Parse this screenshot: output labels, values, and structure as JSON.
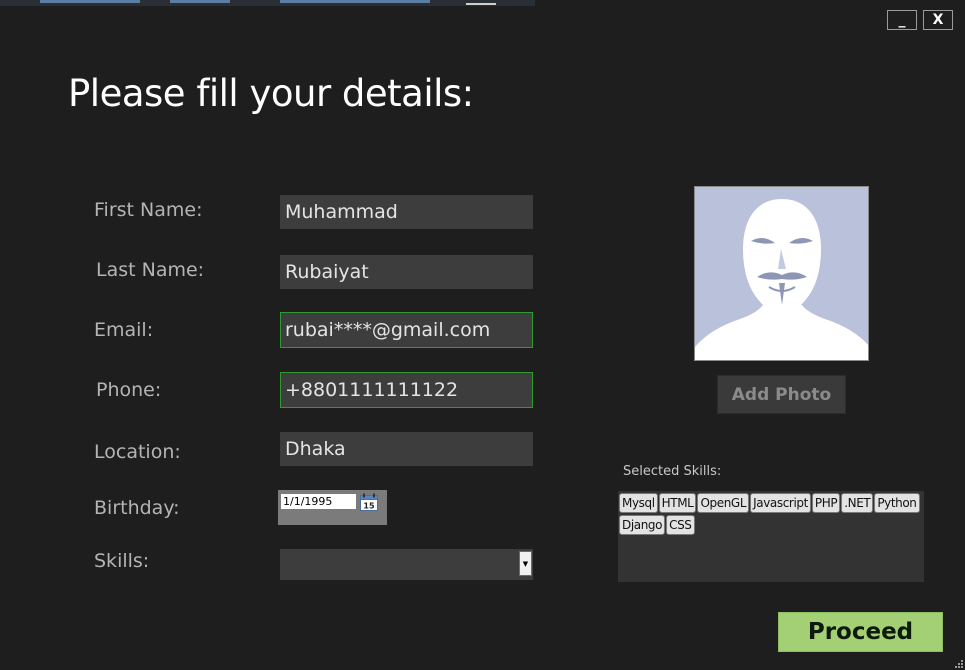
{
  "window": {
    "minimize_label": "_",
    "close_label": "X"
  },
  "heading": "Please fill your details:",
  "form": {
    "first_name": {
      "label": "First Name:",
      "value": "Muhammad"
    },
    "last_name": {
      "label": "Last Name:",
      "value": "Rubaiyat"
    },
    "email": {
      "label": "Email:",
      "value": "rubai****@gmail.com"
    },
    "phone": {
      "label": "Phone:",
      "value": "+8801111111122"
    },
    "location": {
      "label": "Location:",
      "value": "Dhaka"
    },
    "birthday": {
      "label": "Birthday:",
      "value": "1/1/1995",
      "calendar_day": "15"
    },
    "skills": {
      "label": "Skills:",
      "value": ""
    }
  },
  "photo": {
    "add_label": "Add Photo",
    "icon": "anonymous-mask-avatar"
  },
  "selected_skills": {
    "title": "Selected Skills:",
    "items": [
      "Mysql",
      "HTML",
      "OpenGL",
      "Javascript",
      "PHP",
      ".NET",
      "Python",
      "Django",
      "CSS"
    ]
  },
  "proceed_label": "Proceed",
  "colors": {
    "background": "#1e1e1e",
    "field": "#3d3d3d",
    "valid_border": "#2f9a2f",
    "proceed": "#a3d075"
  }
}
